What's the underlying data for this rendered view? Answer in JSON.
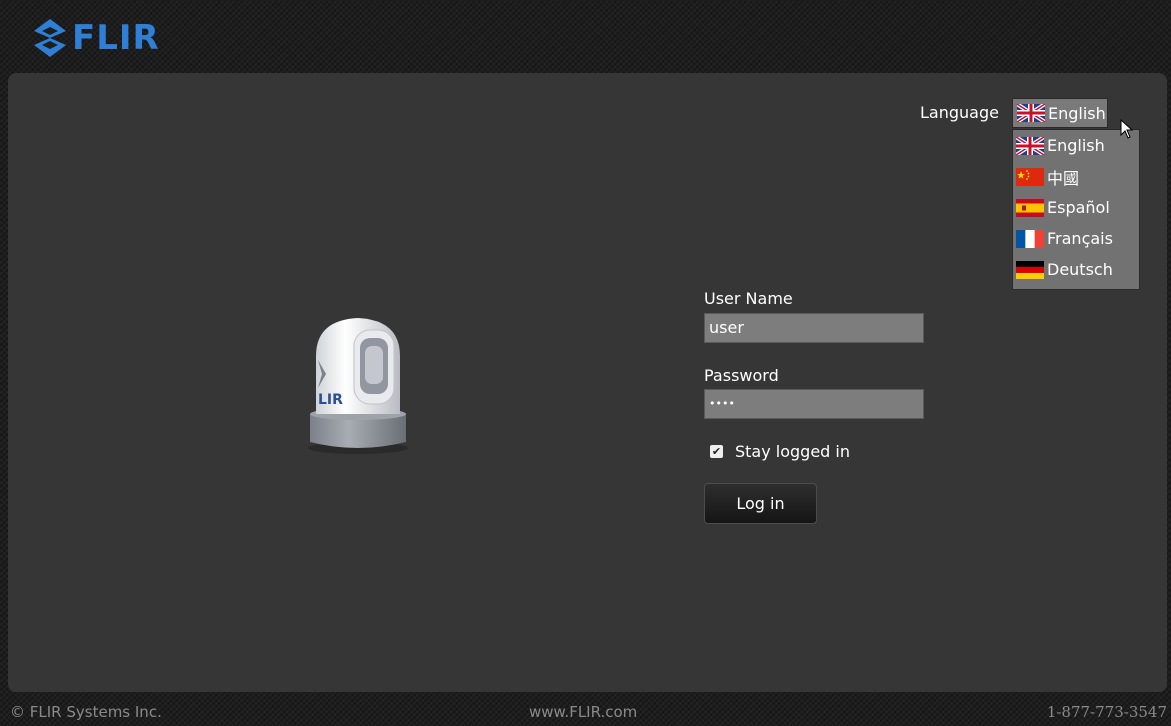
{
  "header": {
    "logo_text": "FLIR"
  },
  "language": {
    "label": "Language",
    "selected": "English",
    "options": [
      "English",
      "中國",
      "Español",
      "Français",
      "Deutsch"
    ]
  },
  "login": {
    "username_label": "User Name",
    "username_value": "user",
    "password_label": "Password",
    "password_value": "••••",
    "stay_logged_in_label": "Stay logged in",
    "stay_logged_in_checked": true,
    "login_button": "Log in"
  },
  "camera": {
    "brand_text": "LIR"
  },
  "footer": {
    "copyright": "© FLIR Systems Inc.",
    "website": "www.FLIR.com",
    "phone": "1-877-773-3547"
  }
}
